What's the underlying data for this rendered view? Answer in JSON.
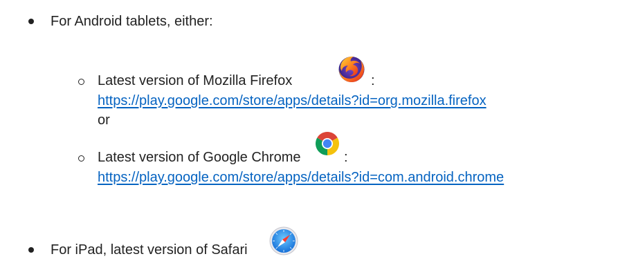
{
  "list": {
    "android": {
      "label": "For Android tablets, either:",
      "firefox": {
        "label": "Latest version of Mozilla Firefox",
        "colon": ":",
        "url": "https://play.google.com/store/apps/details?id=org.mozilla.firefox",
        "or": "or",
        "icon": "firefox-icon"
      },
      "chrome": {
        "label": "Latest version of Google Chrome",
        "colon": ":",
        "url": "https://play.google.com/store/apps/details?id=com.android.chrome",
        "icon": "chrome-icon"
      }
    },
    "ipad": {
      "label": "For iPad, latest version of Safari",
      "icon": "safari-icon"
    }
  },
  "colors": {
    "text": "#222222",
    "link": "#0563c1"
  }
}
